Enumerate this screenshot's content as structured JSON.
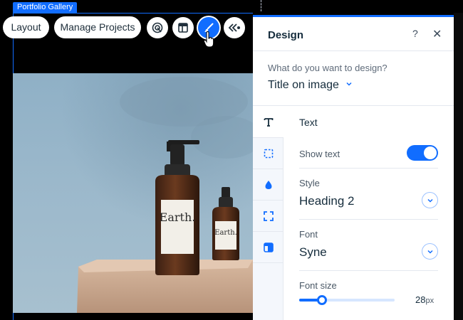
{
  "canvas": {
    "gallery_label": "Portfolio Gallery"
  },
  "toolbar": {
    "layout_label": "Layout",
    "manage_projects_label": "Manage Projects",
    "icons": [
      "animation-icon",
      "layout-template-icon",
      "design-brush-icon",
      "navigate-back-icon"
    ]
  },
  "photo": {
    "bottle_large_text": "Earth.",
    "bottle_small_text": "Earth."
  },
  "panel": {
    "title": "Design",
    "help_label": "?",
    "close_label": "✕",
    "question_label": "What do you want to design?",
    "selected_element": "Title on image",
    "nav_items": [
      "text-icon",
      "corners-icon",
      "color-drop-icon",
      "border-icon",
      "layout-icon"
    ],
    "section_title": "Text",
    "show_text": {
      "label": "Show text",
      "on": true
    },
    "style": {
      "label": "Style",
      "value": "Heading 2"
    },
    "font": {
      "label": "Font",
      "value": "Syne"
    },
    "font_size": {
      "label": "Font size",
      "value": "28",
      "unit": "px",
      "level": 0.24
    }
  },
  "colors": {
    "accent": "#116dff",
    "panel_bg": "#ffffff",
    "nav_bg": "#f4f7fc",
    "text_dark": "#162d3d"
  }
}
